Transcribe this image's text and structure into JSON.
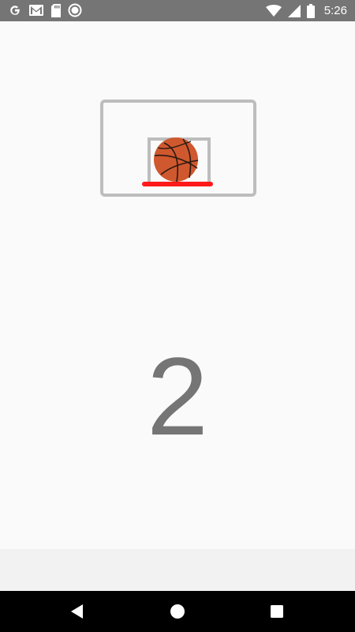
{
  "status_bar": {
    "time": "5:26",
    "left_icons": [
      "google-icon",
      "gmail-icon",
      "sd-card-icon",
      "record-icon"
    ],
    "right_icons": [
      "wifi-icon",
      "cell-signal-icon",
      "battery-icon"
    ],
    "background": "#757575"
  },
  "game": {
    "score": "2",
    "backboard_color": "#bdbdbd",
    "rim_color": "#ff1a1a",
    "ball_color": "#cc5a2c"
  },
  "nav_bar": {
    "buttons": [
      "back-icon",
      "home-icon",
      "recents-icon"
    ]
  }
}
